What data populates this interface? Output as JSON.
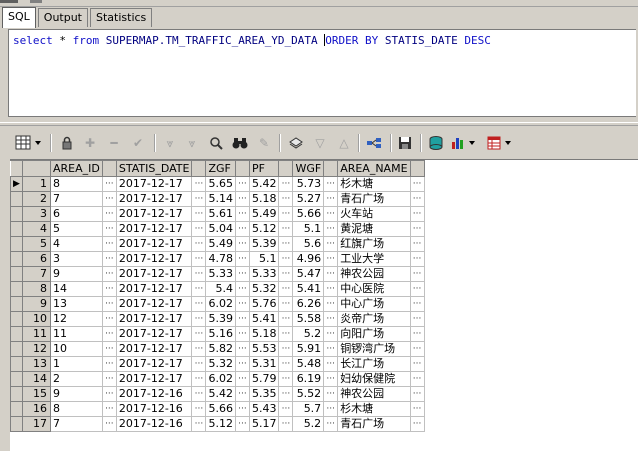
{
  "tabs": [
    {
      "label": "SQL"
    },
    {
      "label": "Output"
    },
    {
      "label": "Statistics"
    }
  ],
  "sql_editor": {
    "kw_select": "select",
    "star": " * ",
    "kw_from": "from",
    "table_name": " SUPERMAP.TM_TRAFFIC_AREA_YD_DATA ",
    "kw_order_by": "ORDER BY",
    "order_column": " STATIS_DATE ",
    "kw_desc": "DESC"
  },
  "toolbar": {
    "icons": [
      "grid-options-icon",
      "lock-icon",
      "add-record-icon",
      "delete-record-icon",
      "post-edit-icon",
      "query-by-example-icon",
      "clear-qbe-icon",
      "find-icon",
      "binoculars-icon",
      "eraser-icon",
      "export-icon",
      "filter-icon",
      "sort-icon",
      "link-icon",
      "save-icon",
      "database-icon",
      "chart-icon",
      "table-icon"
    ]
  },
  "grid": {
    "columns": [
      "AREA_ID",
      "STATIS_DATE",
      "ZGF",
      "PF",
      "WGF",
      "AREA_NAME"
    ],
    "rows": [
      {
        "n": "1",
        "area_id": "8",
        "date": "2017-12-17",
        "zgf": "5.65",
        "pf": "5.42",
        "wgf": "5.73",
        "name": "杉木塘"
      },
      {
        "n": "2",
        "area_id": "7",
        "date": "2017-12-17",
        "zgf": "5.14",
        "pf": "5.18",
        "wgf": "5.27",
        "name": "青石广场"
      },
      {
        "n": "3",
        "area_id": "6",
        "date": "2017-12-17",
        "zgf": "5.61",
        "pf": "5.49",
        "wgf": "5.66",
        "name": "火车站"
      },
      {
        "n": "4",
        "area_id": "5",
        "date": "2017-12-17",
        "zgf": "5.04",
        "pf": "5.12",
        "wgf": "5.1",
        "name": "黄泥塘"
      },
      {
        "n": "5",
        "area_id": "4",
        "date": "2017-12-17",
        "zgf": "5.49",
        "pf": "5.39",
        "wgf": "5.6",
        "name": "红旗广场"
      },
      {
        "n": "6",
        "area_id": "3",
        "date": "2017-12-17",
        "zgf": "4.78",
        "pf": "5.1",
        "wgf": "4.96",
        "name": "工业大学"
      },
      {
        "n": "7",
        "area_id": "9",
        "date": "2017-12-17",
        "zgf": "5.33",
        "pf": "5.33",
        "wgf": "5.47",
        "name": "神农公园"
      },
      {
        "n": "8",
        "area_id": "14",
        "date": "2017-12-17",
        "zgf": "5.4",
        "pf": "5.32",
        "wgf": "5.41",
        "name": "中心医院"
      },
      {
        "n": "9",
        "area_id": "13",
        "date": "2017-12-17",
        "zgf": "6.02",
        "pf": "5.76",
        "wgf": "6.26",
        "name": "中心广场"
      },
      {
        "n": "10",
        "area_id": "12",
        "date": "2017-12-17",
        "zgf": "5.39",
        "pf": "5.41",
        "wgf": "5.58",
        "name": "炎帝广场"
      },
      {
        "n": "11",
        "area_id": "11",
        "date": "2017-12-17",
        "zgf": "5.16",
        "pf": "5.18",
        "wgf": "5.2",
        "name": "向阳广场"
      },
      {
        "n": "12",
        "area_id": "10",
        "date": "2017-12-17",
        "zgf": "5.82",
        "pf": "5.53",
        "wgf": "5.91",
        "name": "铜锣湾广场"
      },
      {
        "n": "13",
        "area_id": "1",
        "date": "2017-12-17",
        "zgf": "5.32",
        "pf": "5.31",
        "wgf": "5.48",
        "name": "长江广场"
      },
      {
        "n": "14",
        "area_id": "2",
        "date": "2017-12-17",
        "zgf": "6.02",
        "pf": "5.79",
        "wgf": "6.19",
        "name": "妇幼保健院"
      },
      {
        "n": "15",
        "area_id": "9",
        "date": "2017-12-16",
        "zgf": "5.42",
        "pf": "5.35",
        "wgf": "5.52",
        "name": "神农公园"
      },
      {
        "n": "16",
        "area_id": "8",
        "date": "2017-12-16",
        "zgf": "5.66",
        "pf": "5.43",
        "wgf": "5.7",
        "name": "杉木塘"
      },
      {
        "n": "17",
        "area_id": "7",
        "date": "2017-12-16",
        "zgf": "5.12",
        "pf": "5.17",
        "wgf": "5.2",
        "name": "青石广场"
      }
    ]
  }
}
